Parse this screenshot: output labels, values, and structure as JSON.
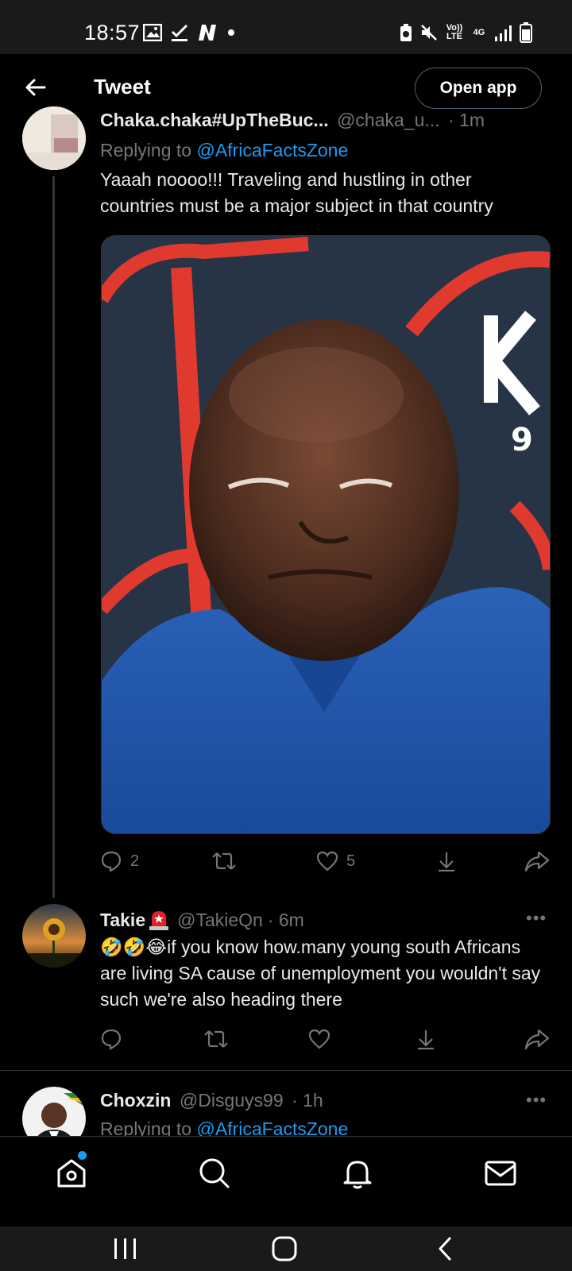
{
  "status_bar": {
    "time": "18:57",
    "network": "4G",
    "volte": "Vo)) LTE"
  },
  "header": {
    "title": "Tweet",
    "open_app": "Open app"
  },
  "tweet1": {
    "display_name": "Chaka.chaka#UpTheBuc...",
    "handle": "@chaka_u...",
    "time": "· 1m",
    "replying_to_prefix": "Replying to ",
    "replying_to_handle": "@AfricaFactsZone",
    "text": "Yaaah noooo!!! Traveling and hustling in other countries must be a major subject in that country",
    "replies": "2",
    "likes": "5"
  },
  "tweet2": {
    "display_name": "Takie",
    "handle": "@TakieQn",
    "time": "· 6m",
    "text": "🤣🤣😂if you know how.many  young south Africans are living SA cause of unemployment you wouldn't say such we're also heading there"
  },
  "tweet3": {
    "display_name": "Choxzin",
    "handle": "@Disguys99",
    "time": "· 1h",
    "replying_to_prefix": "Replying to ",
    "replying_to_handle": "@AfricaFactsZone"
  },
  "more_label": "•••",
  "icons": {
    "back": "arrow-left-icon",
    "reply": "reply-icon",
    "retweet": "retweet-icon",
    "like": "heart-icon",
    "download": "download-icon",
    "share": "share-icon",
    "home": "home-icon",
    "search": "search-icon",
    "notifications": "bell-icon",
    "messages": "mail-icon"
  },
  "colors": {
    "accent": "#1d9bf0",
    "muted": "#71767b",
    "background": "#000000"
  }
}
